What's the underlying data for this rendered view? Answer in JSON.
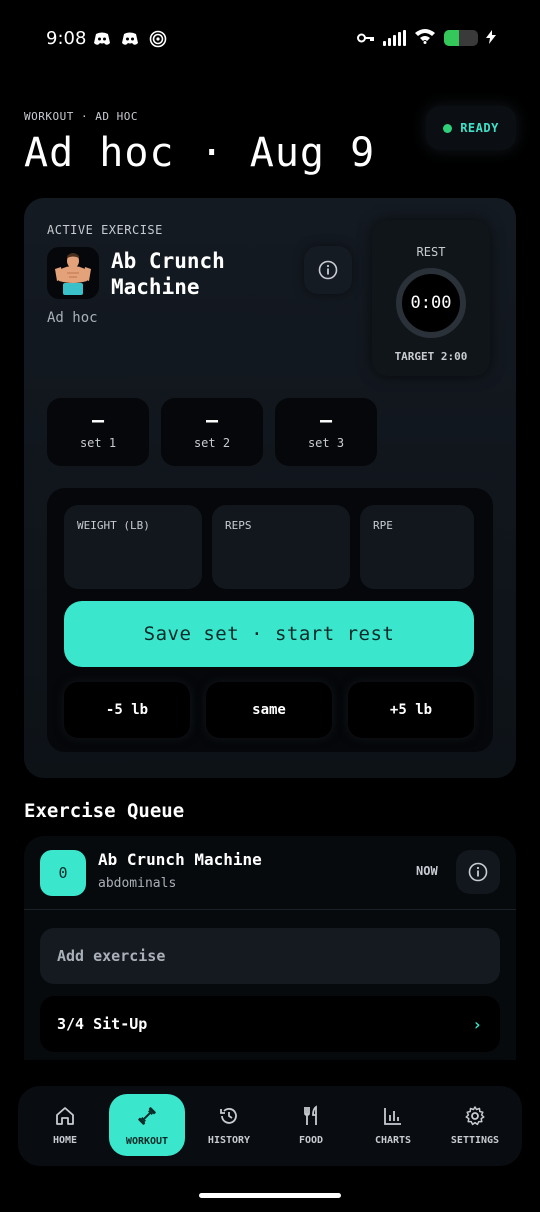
{
  "status_bar": {
    "time": "9:08",
    "battery_level": 0.45
  },
  "header": {
    "eyebrow": "WORKOUT · AD HOC",
    "title": "Ad hoc · Aug 9",
    "status_badge": "READY"
  },
  "active_exercise": {
    "label": "ACTIVE EXERCISE",
    "name": "Ab Crunch Machine",
    "subtitle": "Ad hoc",
    "rest": {
      "label": "REST",
      "time": "0:00",
      "target": "TARGET 2:00"
    },
    "sets": [
      {
        "value": "–",
        "label": "set 1"
      },
      {
        "value": "–",
        "label": "set 2"
      },
      {
        "value": "–",
        "label": "set 3"
      }
    ],
    "fields": {
      "weight_label": "WEIGHT (LB)",
      "reps_label": "REPS",
      "rpe_label": "RPE"
    },
    "save_button": "Save set · start rest",
    "adjust": {
      "minus": "-5 lb",
      "same": "same",
      "plus": "+5 lb"
    }
  },
  "queue": {
    "title": "Exercise Queue",
    "items": [
      {
        "index": "0",
        "name": "Ab Crunch Machine",
        "muscle": "abdominals",
        "tag": "NOW"
      }
    ],
    "add_placeholder": "Add exercise",
    "suggestions": [
      {
        "name": "3/4 Sit-Up"
      }
    ]
  },
  "nav": {
    "home": "HOME",
    "workout": "WORKOUT",
    "history": "HISTORY",
    "food": "FOOD",
    "charts": "CHARTS",
    "settings": "SETTINGS"
  },
  "colors": {
    "accent": "#3ae6cc",
    "ready_dot": "#2fd07a",
    "battery": "#34c759"
  }
}
